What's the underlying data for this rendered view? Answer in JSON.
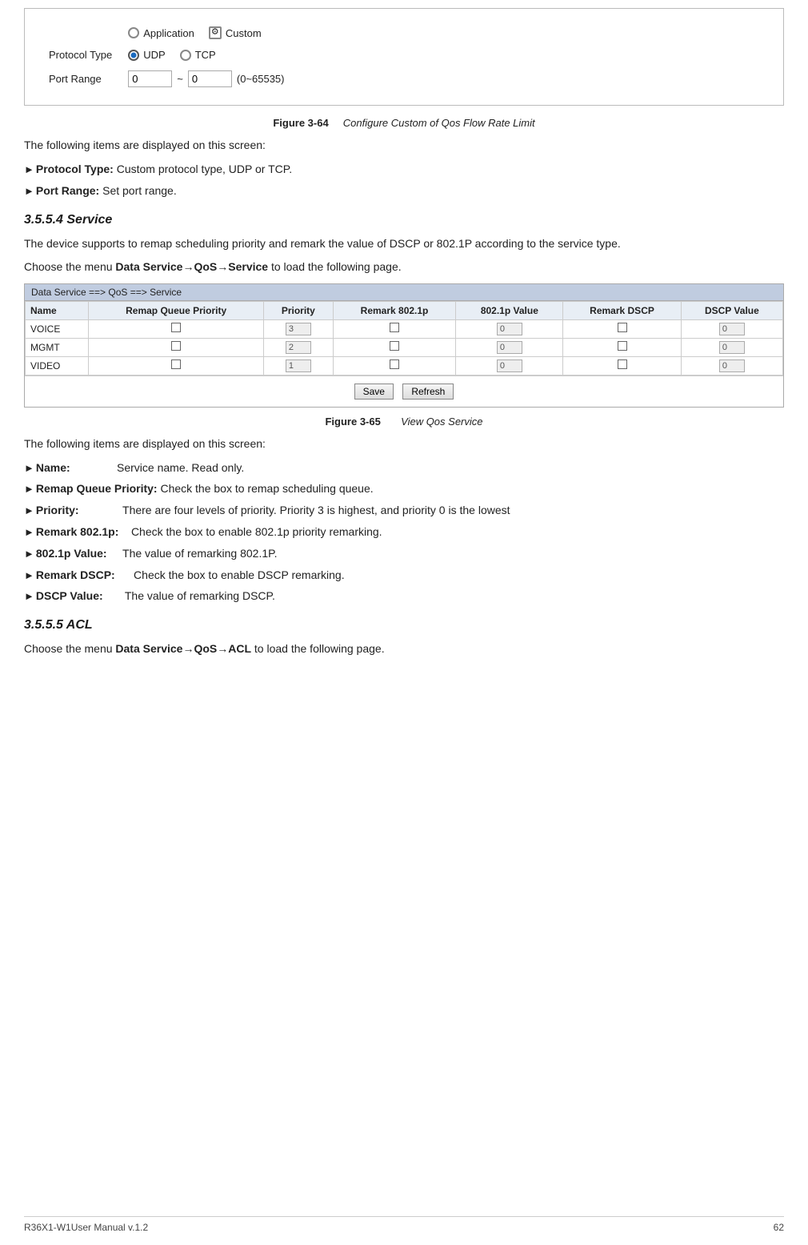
{
  "top_figure": {
    "title_num": "Figure 3-64",
    "title_text": "Configure Custom of Qos Flow Rate Limit",
    "rows": [
      {
        "label": "",
        "content_type": "radio_row",
        "options": [
          {
            "label": "Application",
            "checked": false,
            "has_icon": false
          },
          {
            "label": "Custom",
            "checked": false,
            "has_icon": true
          }
        ]
      },
      {
        "label": "Protocol Type",
        "content_type": "protocol_radio",
        "options": [
          {
            "label": "UDP",
            "checked": true
          },
          {
            "label": "TCP",
            "checked": false
          }
        ]
      },
      {
        "label": "Port Range",
        "content_type": "port_range",
        "from_val": "0",
        "to_val": "0",
        "hint": "(0~65535)"
      }
    ]
  },
  "intro_text": "The following items are displayed on this screen:",
  "items_top": [
    {
      "label": "Protocol Type:",
      "text": "Custom protocol type, UDP or TCP."
    },
    {
      "label": "Port Range:",
      "text": "  Set port range."
    }
  ],
  "section1": {
    "heading": "3.5.5.4  Service",
    "para1": "The device supports to remap scheduling priority and remark the value of DSCP or 802.1P according to the service type.",
    "para2": "Choose the menu ",
    "menu_path": "Data Service→QoS→Service",
    "para2_end": " to load the following page."
  },
  "service_table": {
    "title": "Data Service ==> QoS ==> Service",
    "columns": [
      "Name",
      "Remap Queue Priority",
      "Priority",
      "Remark 802.1p",
      "802.1p Value",
      "Remark DSCP",
      "DSCP Value"
    ],
    "rows": [
      {
        "name": "VOICE",
        "priority_val": "3",
        "value_802": "0",
        "dscp_val": "0"
      },
      {
        "name": "MGMT",
        "priority_val": "2",
        "value_802": "0",
        "dscp_val": "0"
      },
      {
        "name": "VIDEO",
        "priority_val": "1",
        "value_802": "0",
        "dscp_val": "0"
      }
    ],
    "buttons": [
      "Save",
      "Refresh"
    ]
  },
  "fig65": {
    "title_num": "Figure 3-65",
    "title_text": "View Qos Service"
  },
  "intro_text2": "The following items are displayed on this screen:",
  "items_bottom": [
    {
      "label": "Name:",
      "indent": "             ",
      "text": "Service name. Read only."
    },
    {
      "label": "Remap Queue Priority:",
      "text": " Check the box to remap scheduling queue."
    },
    {
      "label": "Priority:",
      "indent": "           ",
      "text": " There are four levels of priority. Priority 3 is highest, and priority 0 is the lowest"
    },
    {
      "label": "Remark 802.1p:",
      "indent": "    ",
      "text": " Check the box to enable 802.1p priority remarking."
    },
    {
      "label": "802.1p Value:",
      "indent": "     ",
      "text": " The value of remarking 802.1P."
    },
    {
      "label": "Remark DSCP:",
      "indent": "      ",
      "text": " Check the box to enable DSCP remarking."
    },
    {
      "label": "DSCP Value:",
      "indent": "       ",
      "text": " The value of remarking DSCP."
    }
  ],
  "section2": {
    "heading": "3.5.5.5  ACL",
    "para": "Choose the menu ",
    "menu_path": "Data Service→QoS→ACL",
    "para_end": " to load the following page."
  },
  "footer": {
    "left": "R36X1-W1User Manual v.1.2",
    "right": "62"
  }
}
